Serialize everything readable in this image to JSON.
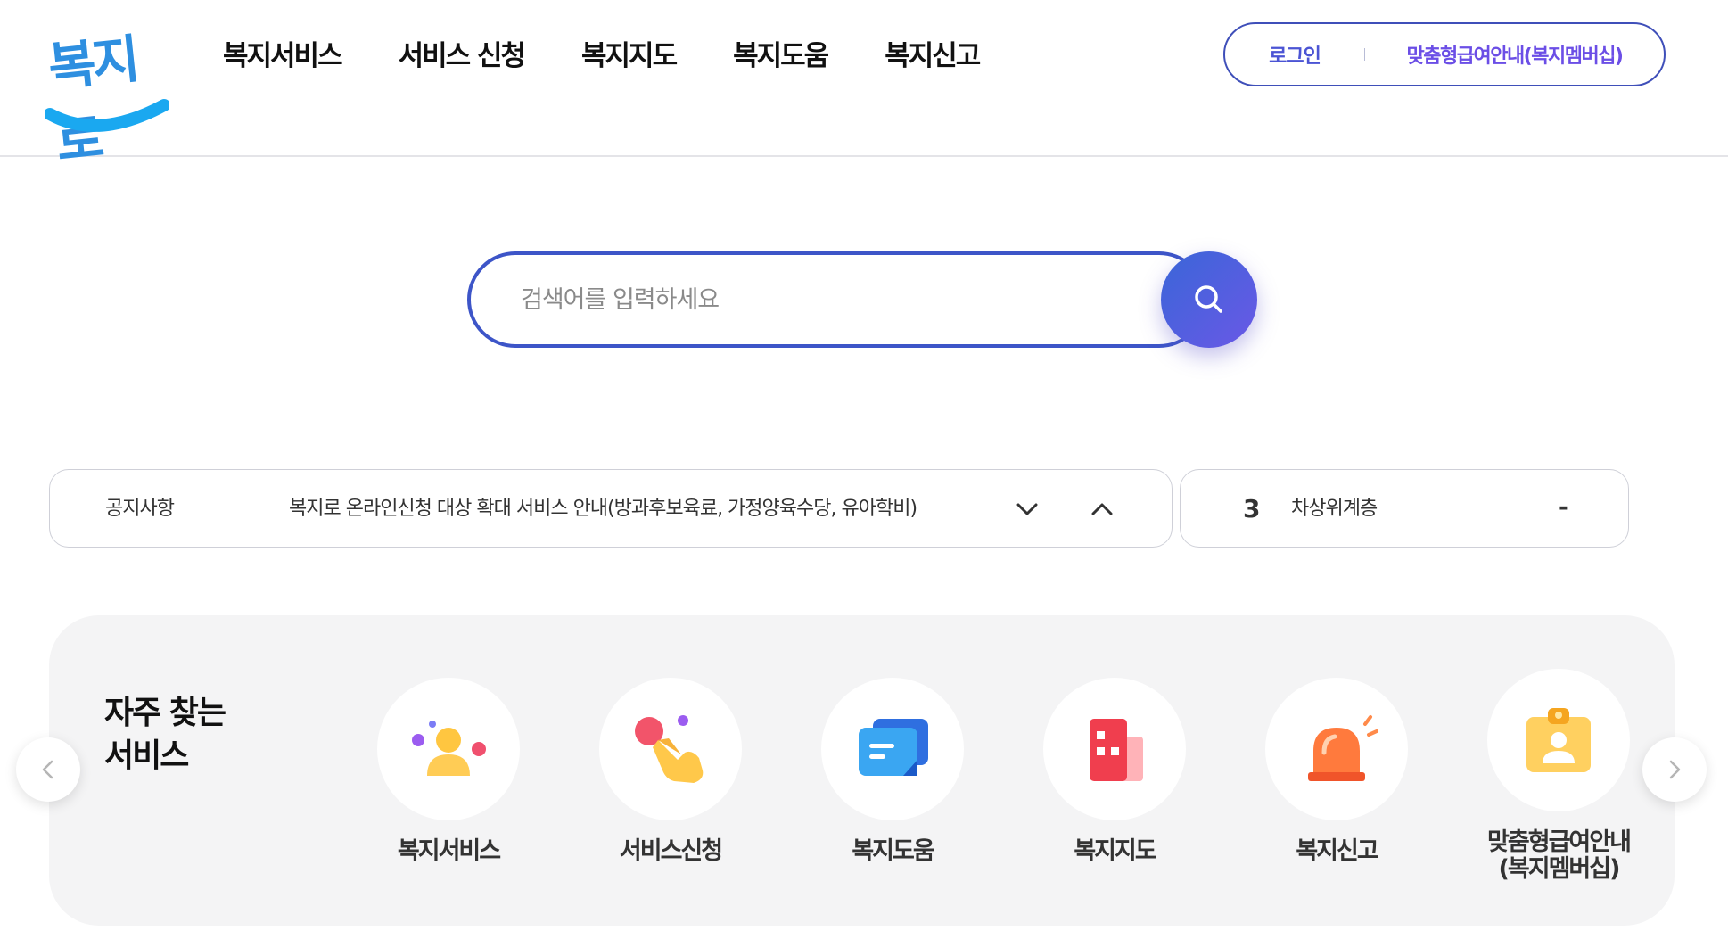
{
  "header": {
    "logo_text": "복지로",
    "nav": [
      "복지서비스",
      "서비스 신청",
      "복지지도",
      "복지도움",
      "복지신고"
    ],
    "login": "로그인",
    "membership": "맞춤형급여안내(복지멤버십)"
  },
  "search": {
    "placeholder": "검색어를 입력하세요"
  },
  "notice": {
    "label": "공지사항",
    "text": "복지로 온라인신청 대상 확대 서비스 안내(방과후보육료, 가정양육수당, 유아학비)"
  },
  "ranking": {
    "rank": "3",
    "keyword": "차상위계층",
    "change": "-"
  },
  "frequent": {
    "title_line1": "자주 찾는",
    "title_line2": "서비스",
    "items": [
      {
        "label": "복지서비스",
        "icon": "people-icon"
      },
      {
        "label": "서비스신청",
        "icon": "hand-pointer-icon"
      },
      {
        "label": "복지도움",
        "icon": "chat-card-icon"
      },
      {
        "label": "복지지도",
        "icon": "building-map-icon"
      },
      {
        "label": "복지신고",
        "icon": "siren-icon"
      },
      {
        "label_line1": "맞춤형급여안내",
        "label_line2": "(복지멤버십)",
        "icon": "id-badge-icon"
      }
    ]
  },
  "colors": {
    "primary": "#3d55c8",
    "accent_purple": "#6b4ee6",
    "logo_blue": "#2e8fe0",
    "panel_bg": "#f4f4f5"
  }
}
